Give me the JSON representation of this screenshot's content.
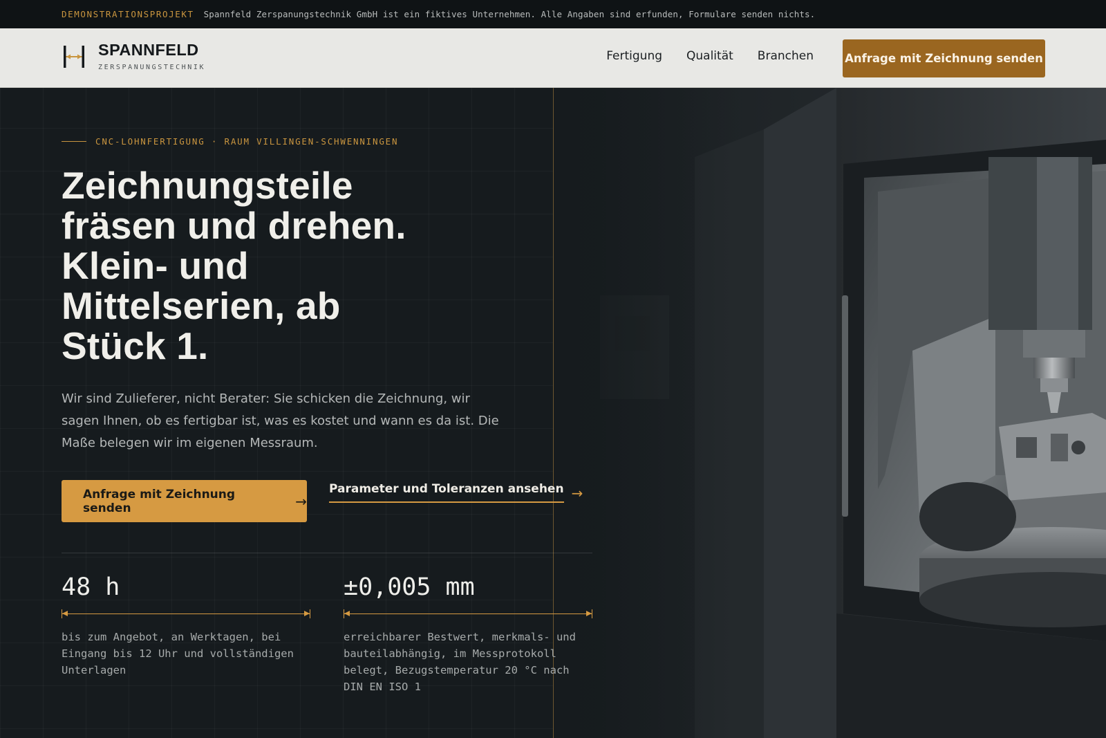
{
  "topbar": {
    "tag": "DEMONSTRATIONSPROJEKT",
    "note": "Spannfeld Zerspanungstechnik GmbH ist ein fiktives Unternehmen. Alle Angaben sind erfunden, Formulare senden nichts."
  },
  "header": {
    "brand": "SPANNFELD",
    "brand_sub": "ZERSPANUNGSTECHNIK",
    "nav": [
      "Fertigung",
      "Qualität",
      "Branchen"
    ],
    "cta": "Anfrage mit Zeichnung senden"
  },
  "hero": {
    "kicker": "CNC-LOHNFERTIGUNG · RAUM VILLINGEN-SCHWENNINGEN",
    "headline": [
      "Zeichnungsteile",
      "fräsen und drehen.",
      "Klein- und",
      "Mittelserien, ab",
      "Stück 1."
    ],
    "intro": "Wir sind Zulieferer, nicht Berater: Sie schicken die Zeichnung, wir sagen Ihnen, ob es fertigbar ist, was es kostet und wann es da ist. Die Maße belegen wir im eigenen Messraum.",
    "cta_primary": "Anfrage mit Zeichnung senden",
    "cta_secondary": "Parameter und Toleranzen ansehen",
    "arrow": "→"
  },
  "stats": [
    {
      "value": "48 h",
      "description": "bis zum Angebot, an Werktagen, bei Eingang bis 12 Uhr und vollständigen Unterlagen"
    },
    {
      "value": "±0,005 mm",
      "description": "erreichbarer Bestwert, merkmals- und bauteilabhängig, im Messprotokoll belegt, Bezugstemperatur 20 °C nach DIN EN ISO 1"
    }
  ],
  "colors": {
    "accent": "#d69a42",
    "accent_dark": "#9a6620",
    "background": "#161b1e",
    "header_bg": "#e8e8e5"
  },
  "icons": [
    "logo-clamp-icon",
    "arrow-right-icon"
  ]
}
